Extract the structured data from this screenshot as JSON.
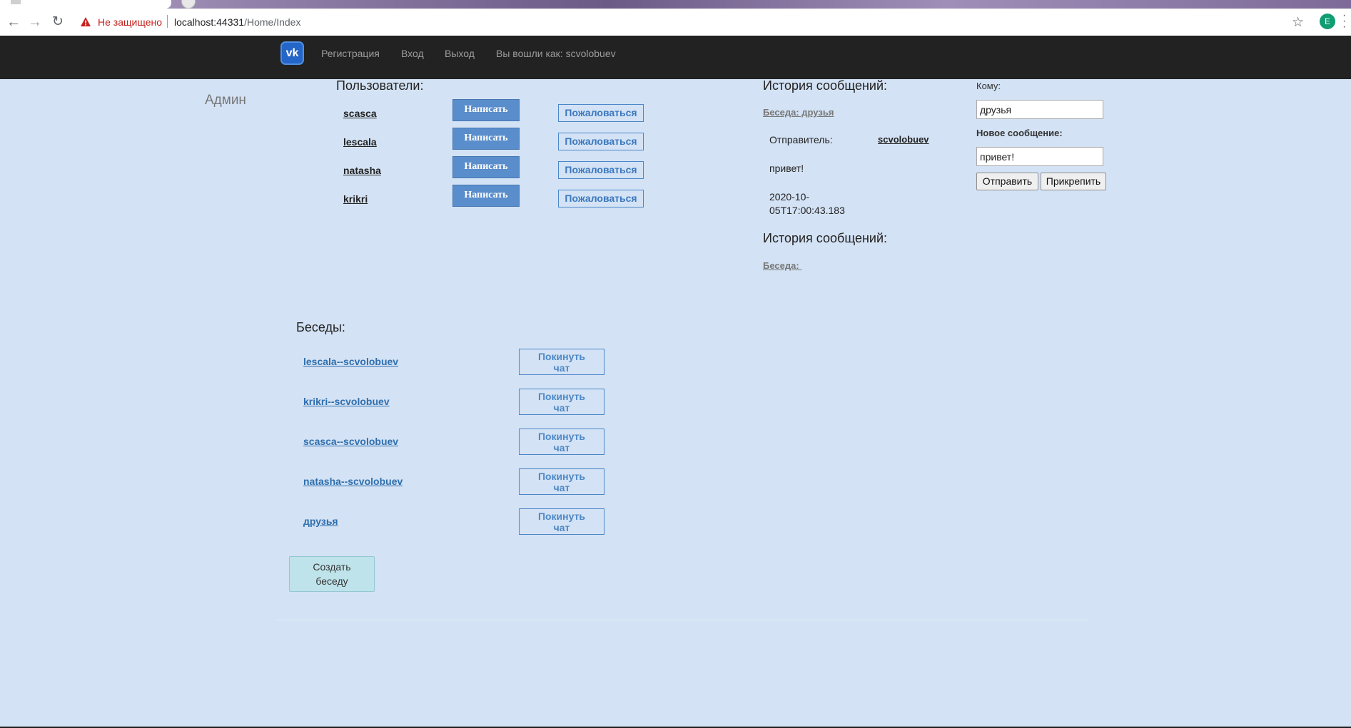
{
  "browser": {
    "warning_text": "Не защищено",
    "url_host": "localhost:44331",
    "url_path": "/Home/Index",
    "profile_initial": "E"
  },
  "navbar": {
    "logo_text": "vk",
    "links": [
      "Регистрация",
      "Вход",
      "Выход",
      "Вы вошли как: scvolobuev"
    ]
  },
  "sidebar": {
    "admin_label": "Админ"
  },
  "users": {
    "heading": "Пользователи:",
    "write_label": "Написать",
    "report_label": "Пожаловаться",
    "list": [
      "scasca",
      "lescala",
      "natasha",
      "krikri"
    ]
  },
  "chats": {
    "heading": "Беседы:",
    "leave_line1": "Покинуть",
    "leave_line2": "чат",
    "list": [
      "lescala--scvolobuev",
      "krikri--scvolobuev",
      "scasca--scvolobuev",
      "natasha--scvolobuev",
      "друзья"
    ],
    "create_line1": "Создать",
    "create_line2": "беседу"
  },
  "history": [
    {
      "heading": "История сообщений:",
      "chat_label": "Беседа: друзья",
      "sender_label": "Отправитель:",
      "sender": "scvolobuev",
      "message": "привет!",
      "timestamp_line1": "2020-10-",
      "timestamp_line2": "05T17:00:43.183"
    },
    {
      "heading": "История сообщений:",
      "chat_label": "Беседа: "
    }
  ],
  "compose": {
    "to_label": "Кому:",
    "to_value": "друзья",
    "new_message_label": "Новое сообщение:",
    "message_value": "привет!",
    "send_label": "Отправить",
    "attach_label": "Прикрепить"
  },
  "colors": {
    "page_bg": "#d3e2f4",
    "navbar_bg": "#222222",
    "write_button": "#5a8dcb",
    "link_blue": "#2f6fae",
    "create_button": "#bfe3ea"
  }
}
